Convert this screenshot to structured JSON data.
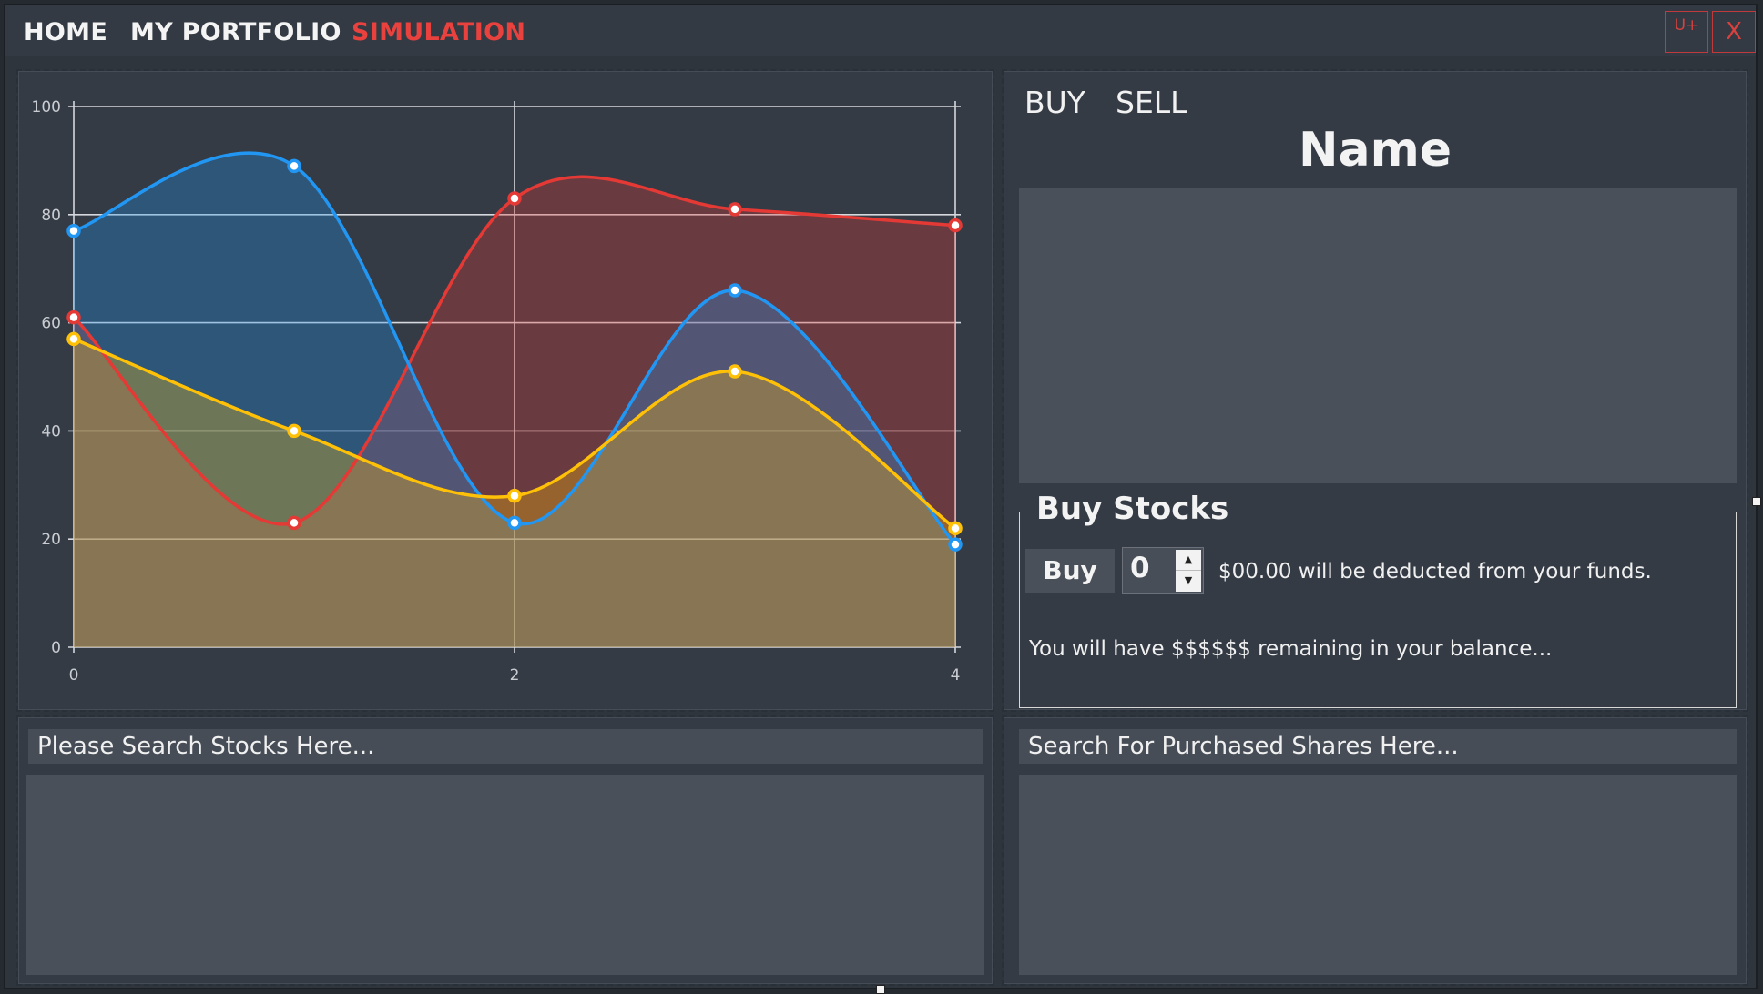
{
  "nav": {
    "home": "HOME",
    "portfolio": "MY PORTFOLIO",
    "simulation": "SIMULATION",
    "active": "simulation"
  },
  "window_controls": {
    "unicode_label": "U+",
    "close_label": "X"
  },
  "colors": {
    "accent": "#e8413e",
    "series_blue": "#2196f3",
    "series_red": "#e53935",
    "series_yellow": "#ffc107"
  },
  "chart_data": {
    "type": "area",
    "x": [
      0,
      1,
      2,
      3,
      4
    ],
    "xlim": [
      0,
      4
    ],
    "ylim": [
      0,
      100
    ],
    "x_ticks": [
      0,
      2,
      4
    ],
    "y_ticks": [
      0,
      20,
      40,
      60,
      80,
      100
    ],
    "grid": true,
    "smooth": true,
    "series": [
      {
        "color": "#e53935",
        "values": [
          61,
          23,
          83,
          81,
          78
        ]
      },
      {
        "color": "#2196f3",
        "values": [
          77,
          89,
          23,
          66,
          19
        ]
      },
      {
        "color": "#ffc107",
        "values": [
          57,
          40,
          28,
          51,
          22
        ]
      }
    ]
  },
  "trade": {
    "tabs": [
      "BUY",
      "SELL"
    ],
    "name_title": "Name",
    "group_title": "Buy Stocks",
    "buy_button": "Buy",
    "quantity": "0",
    "deduct_text": "$00.00 will be deducted from your funds.",
    "balance_text": "You will have $$$$$$ remaining in your balance..."
  },
  "search": {
    "stocks_placeholder": "Please Search Stocks Here...",
    "shares_placeholder": "Search For Purchased Shares Here..."
  }
}
